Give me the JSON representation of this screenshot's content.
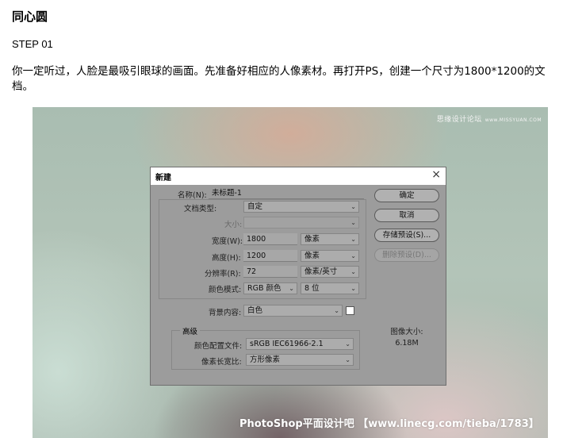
{
  "article": {
    "title": "同心圆",
    "step": "STEP 01",
    "intro": "你一定听过，人脸是最吸引眼球的画面。先准备好相应的人像素材。再打开PS，创建一个尺寸为1800*1200的文档。"
  },
  "figure": {
    "watermark_top": "思缘设计论坛",
    "watermark_top_url": "www.MISSYUAN.COM",
    "watermark_bottom": "PhotoShop平面设计吧 【www.linecg.com/tieba/1783】"
  },
  "dialog": {
    "title": "新建",
    "close_glyph": "×",
    "name_label": "名称(N):",
    "name_value": "未标题-1",
    "doc_type_label": "文档类型:",
    "doc_type_value": "自定",
    "size_label": "大小:",
    "size_value": "",
    "width_label": "宽度(W):",
    "width_value": "1800",
    "width_unit": "像素",
    "height_label": "高度(H):",
    "height_value": "1200",
    "height_unit": "像素",
    "resolution_label": "分辨率(R):",
    "resolution_value": "72",
    "resolution_unit": "像素/英寸",
    "color_mode_label": "颜色模式:",
    "color_mode_value": "RGB 颜色",
    "bit_depth_value": "8 位",
    "background_label": "背景内容:",
    "background_value": "白色",
    "advanced_label": "高级",
    "color_profile_label": "颜色配置文件:",
    "color_profile_value": "sRGB IEC61966-2.1",
    "pixel_aspect_label": "像素长宽比:",
    "pixel_aspect_value": "方形像素",
    "buttons": {
      "ok": "确定",
      "cancel": "取消",
      "save_preset": "存储预设(S)...",
      "delete_preset": "删除预设(D)..."
    },
    "image_size_label": "图像大小:",
    "image_size_value": "6.18M",
    "dropdown_arrow": "⌄"
  }
}
